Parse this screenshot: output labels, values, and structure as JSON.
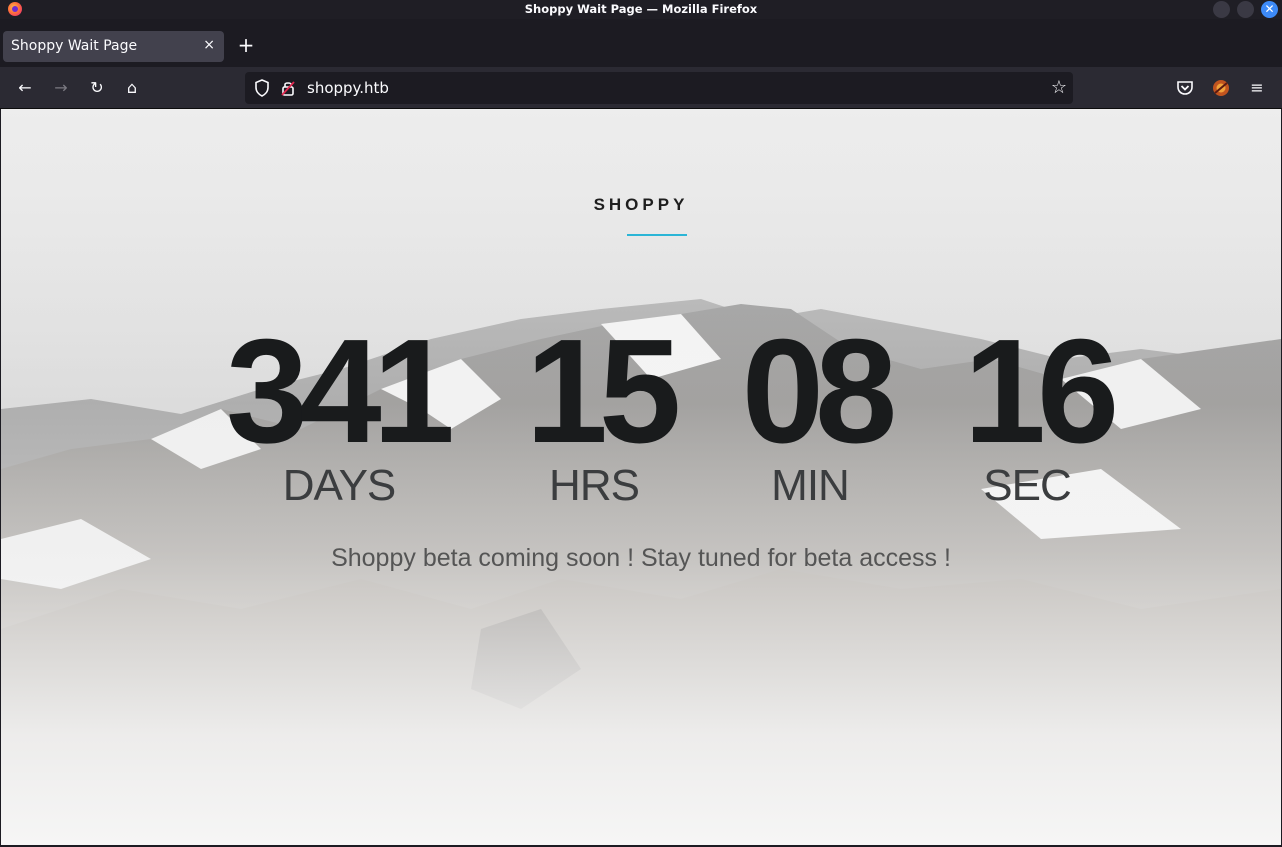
{
  "window": {
    "title": "Shoppy Wait Page — Mozilla Firefox"
  },
  "tabs": [
    {
      "label": "Shoppy Wait Page",
      "close": "×"
    }
  ],
  "newtab": "+",
  "nav": {
    "back": "←",
    "forward": "→",
    "reload": "↻",
    "home": "⌂",
    "url": "shoppy.htb",
    "star": "☆",
    "menu": "≡"
  },
  "page": {
    "brand": "SHOPPY",
    "countdown": [
      {
        "value": "341",
        "label": "DAYS"
      },
      {
        "value": "15",
        "label": "HRS"
      },
      {
        "value": "08",
        "label": "MIN"
      },
      {
        "value": "16",
        "label": "SEC"
      }
    ],
    "tagline": "Shoppy beta coming soon ! Stay tuned for beta access !",
    "accent_color": "#2bb5d6"
  }
}
